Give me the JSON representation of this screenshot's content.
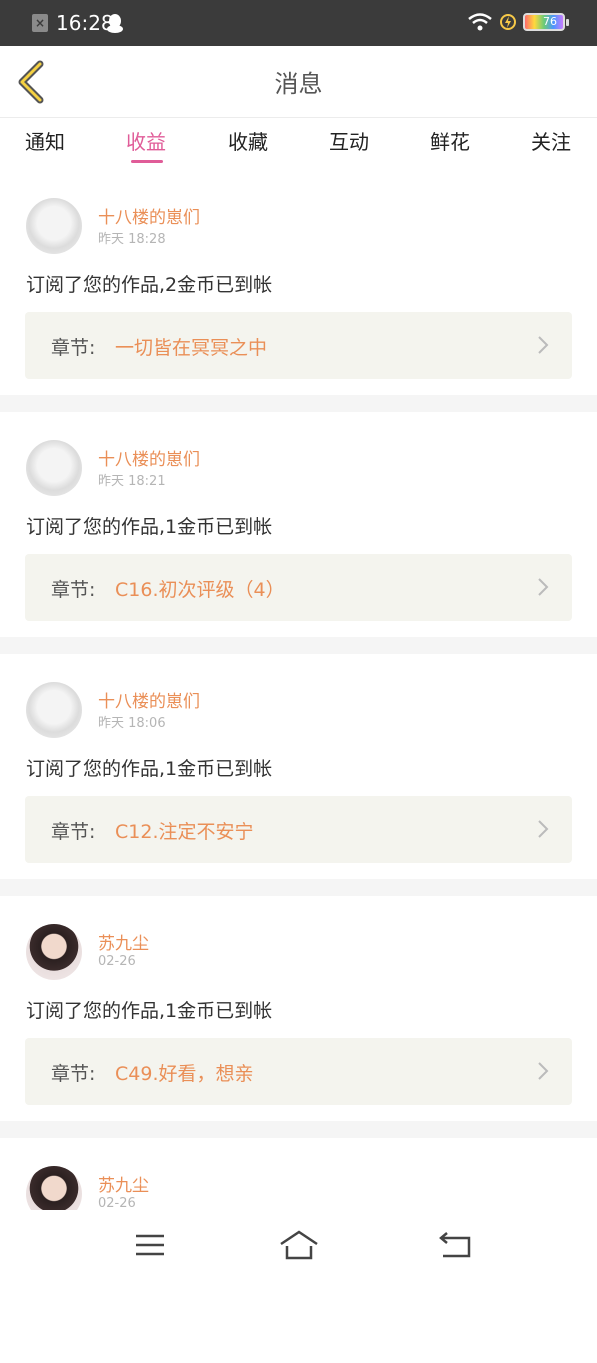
{
  "status_bar": {
    "time": "16:28",
    "battery": "76"
  },
  "header": {
    "title": "消息"
  },
  "tabs": [
    {
      "label": "通知"
    },
    {
      "label": "收益"
    },
    {
      "label": "收藏"
    },
    {
      "label": "互动"
    },
    {
      "label": "鲜花"
    },
    {
      "label": "关注"
    }
  ],
  "active_tab": "收益",
  "colors": {
    "accent": "#e05c98",
    "username": "#ea8f57",
    "chapter_bg": "#f4f4ee"
  },
  "items": [
    {
      "user": "十八楼的崽们",
      "time": "昨天 18:28",
      "message": "订阅了您的作品,2金币已到帐",
      "chapter_label": "章节:",
      "chapter": "一切皆在冥冥之中"
    },
    {
      "user": "十八楼的崽们",
      "time": "昨天 18:21",
      "message": "订阅了您的作品,1金币已到帐",
      "chapter_label": "章节:",
      "chapter": "C16.初次评级（4）"
    },
    {
      "user": "十八楼的崽们",
      "time": "昨天 18:06",
      "message": "订阅了您的作品,1金币已到帐",
      "chapter_label": "章节:",
      "chapter": "C12.注定不安宁"
    },
    {
      "user": "苏九尘",
      "time": "02-26",
      "message": "订阅了您的作品,1金币已到帐",
      "chapter_label": "章节:",
      "chapter": "C49.好看，想亲"
    },
    {
      "user": "苏九尘",
      "time": "02-26"
    }
  ]
}
